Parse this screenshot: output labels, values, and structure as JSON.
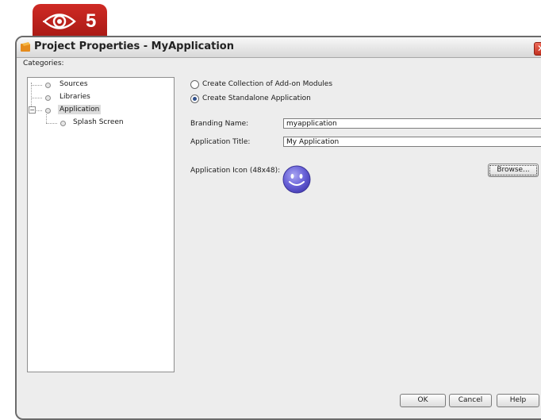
{
  "badge": {
    "step_number": "5",
    "icon": "eye-icon",
    "color": "#c0221d"
  },
  "window": {
    "title": "Project Properties - MyApplication",
    "title_icon": "netbeans-project-icon",
    "close_icon": "close-icon"
  },
  "categories": {
    "label": "Categories:",
    "items": [
      {
        "label": "Sources"
      },
      {
        "label": "Libraries"
      },
      {
        "label": "Application",
        "expanded": true,
        "selected": true
      },
      {
        "label": "Splash Screen",
        "child_of": "Application"
      }
    ]
  },
  "options": {
    "radio_collection": "Create Collection of Add-on Modules",
    "radio_standalone": "Create Standalone Application",
    "selected": "Create Standalone Application"
  },
  "form": {
    "branding_name_label": "Branding Name:",
    "branding_name_value": "myapplication",
    "application_title_label": "Application Title:",
    "application_title_value": "My Application",
    "application_icon_label": "Application Icon (48x48):",
    "icon_preview": "smiley-icon",
    "browse_label": "Browse..."
  },
  "buttons": {
    "ok": "OK",
    "cancel": "Cancel",
    "help": "Help"
  }
}
